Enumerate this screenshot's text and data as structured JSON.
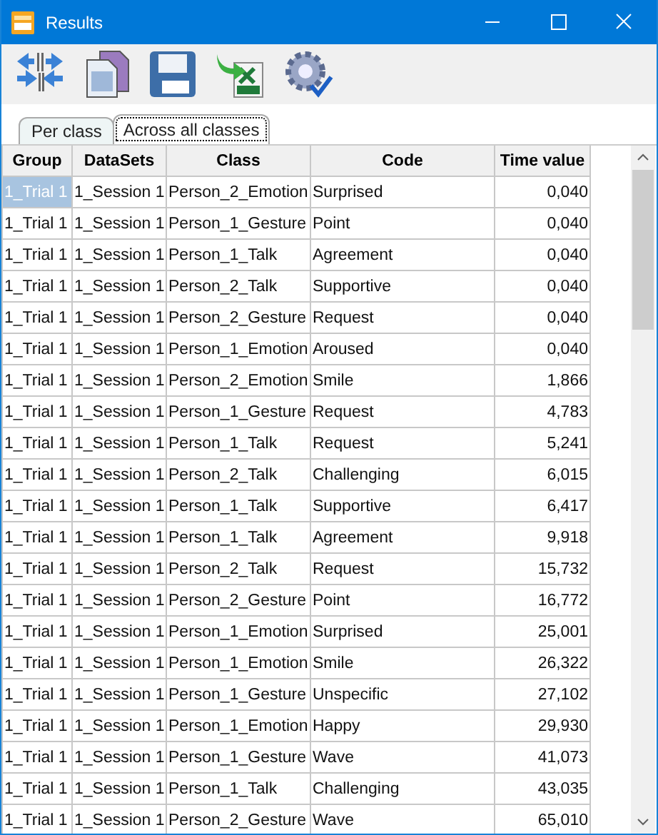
{
  "window": {
    "title": "Results"
  },
  "tabs": [
    {
      "label": "Per class",
      "selected": false
    },
    {
      "label": "Across all classes",
      "selected": true
    }
  ],
  "table": {
    "columns": [
      "Group",
      "DataSets",
      "Class",
      "Code",
      "Time value"
    ],
    "rows": [
      {
        "cells": [
          "1_Trial 1",
          "1_Session 1",
          "Person_2_Emotion",
          "Surprised",
          "0,040"
        ],
        "selected": true
      },
      {
        "cells": [
          "1_Trial 1",
          "1_Session 1",
          "Person_1_Gesture",
          "Point",
          "0,040"
        ],
        "selected": false
      },
      {
        "cells": [
          "1_Trial 1",
          "1_Session 1",
          "Person_1_Talk",
          "Agreement",
          "0,040"
        ],
        "selected": false
      },
      {
        "cells": [
          "1_Trial 1",
          "1_Session 1",
          "Person_2_Talk",
          "Supportive",
          "0,040"
        ],
        "selected": false
      },
      {
        "cells": [
          "1_Trial 1",
          "1_Session 1",
          "Person_2_Gesture",
          "Request",
          "0,040"
        ],
        "selected": false
      },
      {
        "cells": [
          "1_Trial 1",
          "1_Session 1",
          "Person_1_Emotion",
          "Aroused",
          "0,040"
        ],
        "selected": false
      },
      {
        "cells": [
          "1_Trial 1",
          "1_Session 1",
          "Person_2_Emotion",
          "Smile",
          "1,866"
        ],
        "selected": false
      },
      {
        "cells": [
          "1_Trial 1",
          "1_Session 1",
          "Person_1_Gesture",
          "Request",
          "4,783"
        ],
        "selected": false
      },
      {
        "cells": [
          "1_Trial 1",
          "1_Session 1",
          "Person_1_Talk",
          "Request",
          "5,241"
        ],
        "selected": false
      },
      {
        "cells": [
          "1_Trial 1",
          "1_Session 1",
          "Person_2_Talk",
          "Challenging",
          "6,015"
        ],
        "selected": false
      },
      {
        "cells": [
          "1_Trial 1",
          "1_Session 1",
          "Person_1_Talk",
          "Supportive",
          "6,417"
        ],
        "selected": false
      },
      {
        "cells": [
          "1_Trial 1",
          "1_Session 1",
          "Person_1_Talk",
          "Agreement",
          "9,918"
        ],
        "selected": false
      },
      {
        "cells": [
          "1_Trial 1",
          "1_Session 1",
          "Person_2_Talk",
          "Request",
          "15,732"
        ],
        "selected": false
      },
      {
        "cells": [
          "1_Trial 1",
          "1_Session 1",
          "Person_2_Gesture",
          "Point",
          "16,772"
        ],
        "selected": false
      },
      {
        "cells": [
          "1_Trial 1",
          "1_Session 1",
          "Person_1_Emotion",
          "Surprised",
          "25,001"
        ],
        "selected": false
      },
      {
        "cells": [
          "1_Trial 1",
          "1_Session 1",
          "Person_1_Emotion",
          "Smile",
          "26,322"
        ],
        "selected": false
      },
      {
        "cells": [
          "1_Trial 1",
          "1_Session 1",
          "Person_1_Gesture",
          "Unspecific",
          "27,102"
        ],
        "selected": false
      },
      {
        "cells": [
          "1_Trial 1",
          "1_Session 1",
          "Person_1_Emotion",
          "Happy",
          "29,930"
        ],
        "selected": false
      },
      {
        "cells": [
          "1_Trial 1",
          "1_Session 1",
          "Person_1_Gesture",
          "Wave",
          "41,073"
        ],
        "selected": false
      },
      {
        "cells": [
          "1_Trial 1",
          "1_Session 1",
          "Person_1_Talk",
          "Challenging",
          "43,035"
        ],
        "selected": false
      },
      {
        "cells": [
          "1_Trial 1",
          "1_Session 1",
          "Person_2_Gesture",
          "Wave",
          "65,010"
        ],
        "selected": false
      }
    ]
  }
}
